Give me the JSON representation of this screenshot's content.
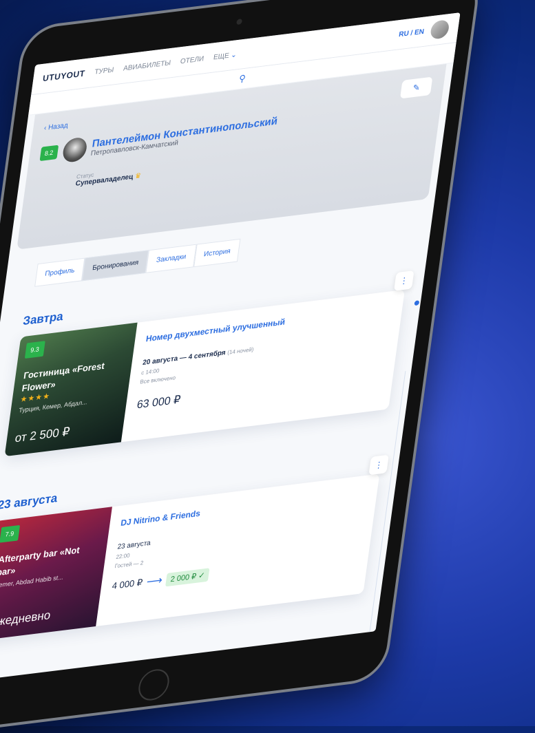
{
  "nav": {
    "logo": "UTUYOUT",
    "items": [
      "ТУРЫ",
      "АВИАБИЛЕТЫ",
      "ОТЕЛИ",
      "ЕЩЕ"
    ],
    "lang": "RU / EN"
  },
  "profile": {
    "back": "Назад",
    "rating": "8.2",
    "name": "Пантелеймон Константинопольский",
    "city": "Петропавловск-Камчатский",
    "status_label": "Статус",
    "status_value": "Суперваладелец"
  },
  "tabs": [
    "Профиль",
    "Бронирования",
    "Закладки",
    "История"
  ],
  "sections": [
    {
      "title": "Завтра",
      "card": {
        "rating": "9.3",
        "img_title": "Гостиница «Forest Flower»",
        "stars": "★★★★",
        "location": "Турция, Кемер, Абдал...",
        "img_price": "от 2 500 ₽",
        "title": "Номер двухместный улучшенный",
        "dates": "20 августа — 4 сентября",
        "nights": "(14 ночей)",
        "time": "с 14:00",
        "extra": "Все включено",
        "price": "63 000 ₽"
      }
    },
    {
      "title": "23 августа",
      "card": {
        "rating": "7.9",
        "img_title": "Afterparty bar «Not bar»",
        "location": "Kemer, Abdad Habib st...",
        "img_price": "Ежедневно",
        "title": "DJ Nitrino & Friends",
        "dates": "23 августа",
        "time": "22:00",
        "guests": "Гостей — 2",
        "old_price": "4 000 ₽",
        "new_price": "2 000 ₽ ✓"
      }
    }
  ],
  "colors": {
    "accent": "#2d6ee0",
    "rating": "#2bb24c",
    "background": "#0c2a7e"
  }
}
